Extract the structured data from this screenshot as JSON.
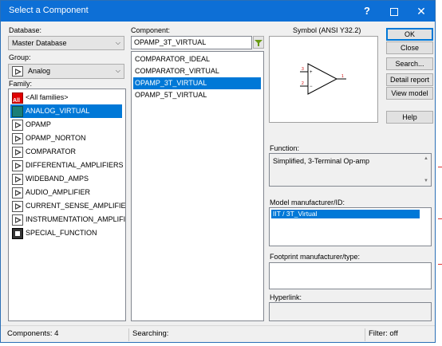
{
  "window": {
    "title": "Select a Component",
    "help_glyph": "?",
    "close_glyph": "✕",
    "minimize_glyph": ""
  },
  "database": {
    "label": "Database:",
    "value": "Master Database"
  },
  "group": {
    "label": "Group:",
    "value": "Analog"
  },
  "family": {
    "label": "Family:",
    "items": [
      {
        "label": "<All families>",
        "icon": "all-families-icon",
        "selected": false
      },
      {
        "label": "ANALOG_VIRTUAL",
        "icon": "virtual-icon",
        "selected": true
      },
      {
        "label": "OPAMP",
        "icon": "opamp-icon",
        "selected": false
      },
      {
        "label": "OPAMP_NORTON",
        "icon": "opamp-norton-icon",
        "selected": false
      },
      {
        "label": "COMPARATOR",
        "icon": "comparator-icon",
        "selected": false
      },
      {
        "label": "DIFFERENTIAL_AMPLIFIERS",
        "icon": "diff-amp-icon",
        "selected": false
      },
      {
        "label": "WIDEBAND_AMPS",
        "icon": "wideband-icon",
        "selected": false
      },
      {
        "label": "AUDIO_AMPLIFIER",
        "icon": "audio-amp-icon",
        "selected": false
      },
      {
        "label": "CURRENT_SENSE_AMPLIFIERS",
        "icon": "current-sense-icon",
        "selected": false
      },
      {
        "label": "INSTRUMENTATION_AMPLIFIE",
        "icon": "instrumentation-icon",
        "selected": false
      },
      {
        "label": "SPECIAL_FUNCTION",
        "icon": "special-function-icon",
        "selected": false
      }
    ]
  },
  "component": {
    "label": "Component:",
    "value": "OPAMP_3T_VIRTUAL",
    "items": [
      {
        "label": "COMPARATOR_IDEAL",
        "selected": false
      },
      {
        "label": "COMPARATOR_VIRTUAL",
        "selected": false
      },
      {
        "label": "OPAMP_3T_VIRTUAL",
        "selected": true
      },
      {
        "label": "OPAMP_5T_VIRTUAL",
        "selected": false
      }
    ]
  },
  "symbol": {
    "label": "Symbol (ANSI Y32.2)"
  },
  "buttons": {
    "ok": "OK",
    "close": "Close",
    "search": "Search...",
    "detail_report": "Detail report",
    "view_model": "View model",
    "help": "Help"
  },
  "function": {
    "label": "Function:",
    "value": "Simplified, 3-Terminal Op-amp"
  },
  "model": {
    "label": "Model manufacturer/ID:",
    "value": "IIT / 3T_Virtual"
  },
  "footprint": {
    "label": "Footprint manufacturer/type:"
  },
  "hyperlink": {
    "label": "Hyperlink:"
  },
  "status": {
    "components": "Components: 4",
    "searching": "Searching:",
    "filter": "Filter: off"
  },
  "colors": {
    "titlebar": "#0d6fd6",
    "selection": "#0078d7"
  }
}
